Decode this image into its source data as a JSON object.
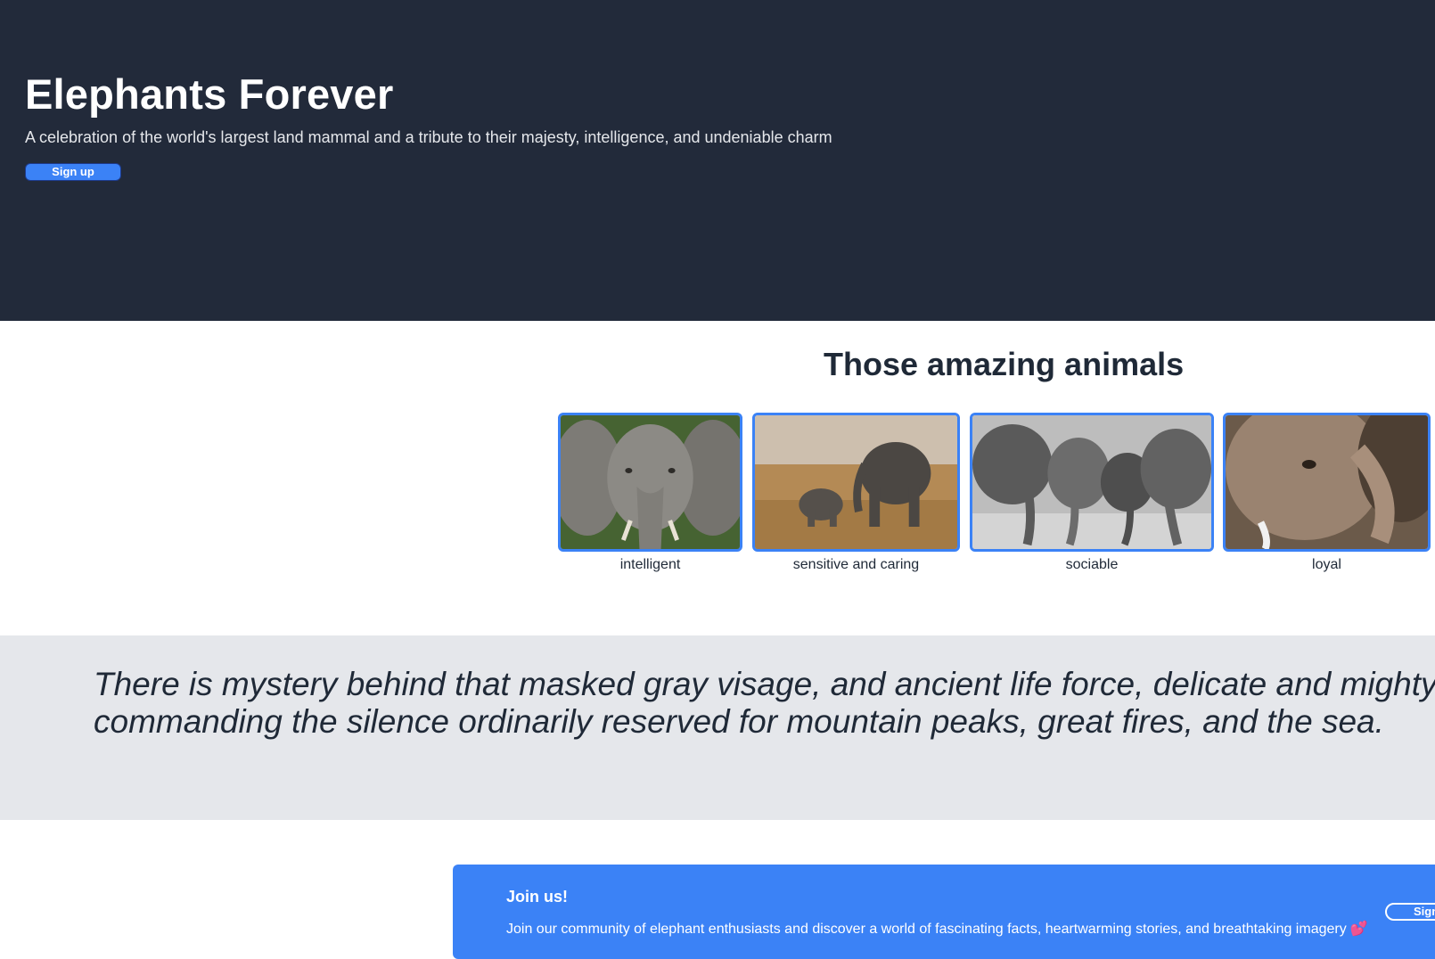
{
  "hero": {
    "title": "Elephants Forever",
    "subtitle": "A celebration of the world's largest land mammal and a tribute to their majesty, intelligence, and undeniable charm",
    "signup_label": "Sign up",
    "background_color": "#222a3a"
  },
  "gallery": {
    "title": "Those amazing animals",
    "accent_color": "#3b82f6",
    "items": [
      {
        "caption": "intelligent",
        "image": "elephant-face-photo"
      },
      {
        "caption": "sensitive and caring",
        "image": "elephant-mother-and-calf-photo"
      },
      {
        "caption": "sociable",
        "image": "elephant-herd-photo"
      },
      {
        "caption": "loyal",
        "image": "elephant-closeup-photo"
      }
    ]
  },
  "quote": {
    "line1": "There is mystery behind that masked gray visage, and ancient life force, delicate and mighty, awesome and",
    "line2": "commanding the silence ordinarily reserved for mountain peaks, great fires, and the sea."
  },
  "join": {
    "title": "Join us!",
    "text": "Join our community of elephant enthusiasts and discover a world of fascinating facts, heartwarming stories, and breathtaking imagery",
    "emoji": "💕",
    "signup_label": "Sign up",
    "background_color": "#3b82f6"
  }
}
